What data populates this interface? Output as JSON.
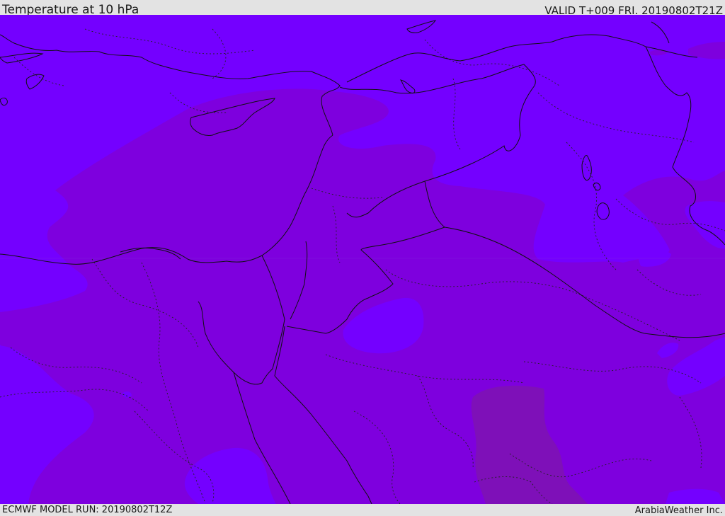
{
  "header": {
    "title": "Temperature at 10 hPa",
    "valid": "VALID T+009 FRI. 20190802T21Z"
  },
  "footer": {
    "model_run": "ECMWF MODEL RUN: 20190802T12Z",
    "credit": "ArabiaWeather Inc."
  },
  "colors": {
    "bar_background": "#e3e3e3",
    "field_light": "#7400ff",
    "field_medium": "#7e00de",
    "field_dark": "#7e10b8",
    "coastline": "#111111"
  }
}
